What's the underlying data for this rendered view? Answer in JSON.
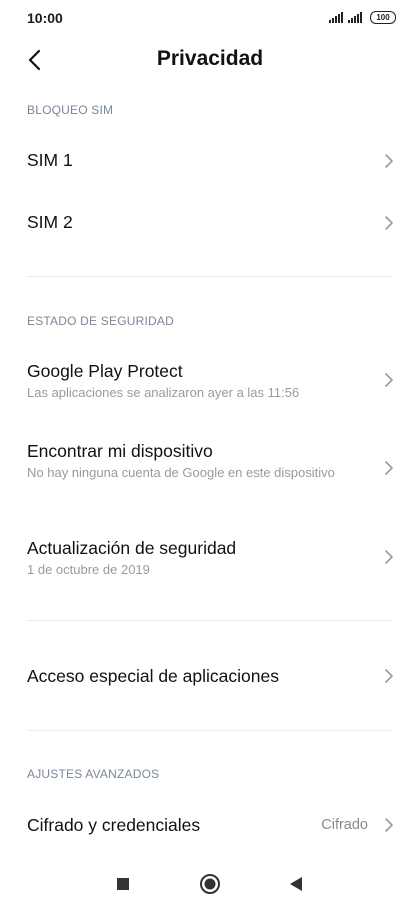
{
  "status_bar": {
    "time": "10:00",
    "battery": "100",
    "icons": [
      "signal-icon",
      "signal-icon",
      "battery-icon"
    ]
  },
  "header": {
    "title": "Privacidad",
    "back_icon": "chevron-left-icon"
  },
  "sections": [
    {
      "header": "BLOQUEO SIM",
      "items": [
        {
          "title": "SIM 1"
        },
        {
          "title": "SIM 2"
        }
      ]
    },
    {
      "header": "ESTADO DE SEGURIDAD",
      "items": [
        {
          "title": "Google Play Protect",
          "subtitle": "Las aplicaciones se analizaron ayer a las 11:56"
        },
        {
          "title": "Encontrar mi dispositivo",
          "subtitle": "No hay ninguna cuenta de Google en este dispositivo"
        },
        {
          "title": "Actualización de seguridad",
          "subtitle": "1 de octubre de 2019"
        }
      ]
    },
    {
      "header": "",
      "items": [
        {
          "title": "Acceso especial de aplicaciones"
        }
      ]
    },
    {
      "header": "AJUSTES AVANZADOS",
      "items": [
        {
          "title": "Cifrado y credenciales",
          "value": "Cifrado"
        }
      ]
    }
  ],
  "nav_bar": {
    "icons": [
      "recents-square-icon",
      "home-circle-icon",
      "back-triangle-icon"
    ]
  },
  "colors": {
    "section_header": "#7a8699",
    "subtitle": "#9a9a9a",
    "chevron": "#9a9a9a",
    "divider": "#ececec"
  }
}
